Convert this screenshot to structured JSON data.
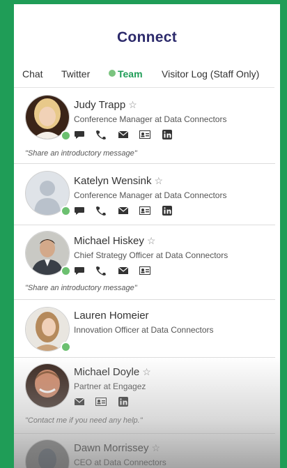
{
  "title": "Connect",
  "tabs": [
    {
      "label": "Chat",
      "active": false
    },
    {
      "label": "Twitter",
      "active": false
    },
    {
      "label": "Team",
      "active": true
    },
    {
      "label": "Visitor Log (Staff Only)",
      "active": false
    }
  ],
  "people": [
    {
      "name": "Judy Trapp",
      "role": "Conference Manager at Data Connectors",
      "message": "\"Share an introductory message\"",
      "icons": [
        "chat-icon",
        "phone-icon",
        "email-icon",
        "vcard-icon",
        "linkedin-icon"
      ]
    },
    {
      "name": "Katelyn Wensink",
      "role": "Conference Manager at Data Connectors",
      "message": "",
      "icons": [
        "chat-icon",
        "phone-icon",
        "email-icon",
        "vcard-icon",
        "linkedin-icon"
      ]
    },
    {
      "name": "Michael Hiskey",
      "role": "Chief Strategy Officer at Data Connectors",
      "message": "\"Share an introductory message\"",
      "icons": [
        "chat-icon",
        "phone-icon",
        "email-icon",
        "vcard-icon"
      ]
    },
    {
      "name": "Lauren Homeier",
      "role": "Innovation Officer at Data Connectors",
      "message": "",
      "icons": []
    },
    {
      "name": "Michael Doyle",
      "role": "Partner at Engagez",
      "message": "\"Contact me if you need any help.\"",
      "icons": [
        "email-icon",
        "vcard-icon",
        "linkedin-icon"
      ]
    },
    {
      "name": "Dawn Morrissey",
      "role": "CEO at Data Connectors",
      "message": "",
      "icons": []
    }
  ],
  "colors": {
    "accent": "#1f9d57",
    "title": "#2c2a6b",
    "status_online": "#6cc070"
  },
  "star_glyph": "☆"
}
